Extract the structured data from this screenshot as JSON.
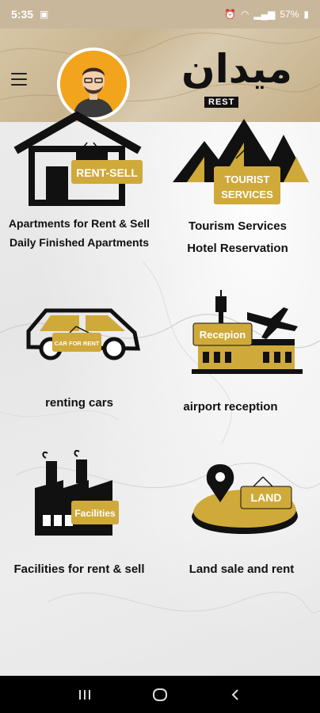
{
  "status_bar": {
    "time": "5:35",
    "battery": "57%"
  },
  "header": {
    "logo_arabic": "ميدان",
    "logo_sub": "REST"
  },
  "tiles": [
    {
      "id": "apartments",
      "icon": "house-icon",
      "tag": "RENT-SELL",
      "lines": [
        "Apartments for Rent & Sell",
        "Daily Finished Apartments"
      ]
    },
    {
      "id": "tourism",
      "icon": "pyramids-icon",
      "tag": [
        "TOURIST",
        "SERVICES"
      ],
      "lines": [
        "Tourism Services",
        "Hotel Reservation"
      ]
    },
    {
      "id": "cars",
      "icon": "car-icon",
      "tag": "CAR FOR RENT",
      "lines": [
        "renting cars"
      ]
    },
    {
      "id": "airport",
      "icon": "airport-icon",
      "tag": "Recepion",
      "lines": [
        "airport reception"
      ]
    },
    {
      "id": "facilities",
      "icon": "factory-icon",
      "tag": "Facilities",
      "lines": [
        "Facilities for rent & sell"
      ]
    },
    {
      "id": "land",
      "icon": "land-icon",
      "tag": "LAND",
      "lines": [
        "Land sale and rent"
      ]
    }
  ],
  "colors": {
    "gold": "#cfa93a",
    "dark": "#111111",
    "header": "#cdb892",
    "avatar_bg": "#f2a41d"
  }
}
